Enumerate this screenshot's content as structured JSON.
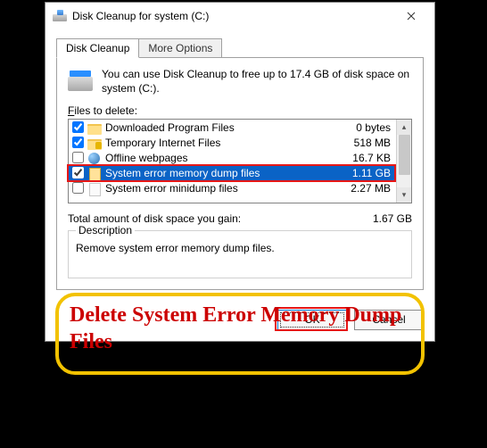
{
  "window": {
    "title": "Disk Cleanup for system (C:)"
  },
  "tabs": {
    "active": "Disk Cleanup",
    "other": "More Options"
  },
  "info": {
    "text": "You can use Disk Cleanup to free up to 17.4 GB of disk space on system (C:)."
  },
  "files_label_pre": "F",
  "files_label_rest": "iles to delete:",
  "files": [
    {
      "checked": true,
      "icon": "folder",
      "label": "Downloaded Program Files",
      "size": "0 bytes"
    },
    {
      "checked": true,
      "icon": "lockfolder",
      "label": "Temporary Internet Files",
      "size": "518 MB"
    },
    {
      "checked": false,
      "icon": "globe",
      "label": "Offline webpages",
      "size": "16.7 KB"
    },
    {
      "checked": true,
      "icon": "file-sel",
      "label": "System error memory dump files",
      "size": "1.11 GB",
      "selected": true
    },
    {
      "checked": false,
      "icon": "file",
      "label": "System error minidump files",
      "size": "2.27 MB"
    }
  ],
  "total": {
    "label": "Total amount of disk space you gain:",
    "value": "1.67 GB"
  },
  "description": {
    "legend": "Description",
    "text": "Remove system error memory dump files."
  },
  "buttons": {
    "ok": "OK",
    "cancel": "Cancel"
  },
  "annotation": {
    "text": "Delete System Error Memory Dump Files"
  }
}
